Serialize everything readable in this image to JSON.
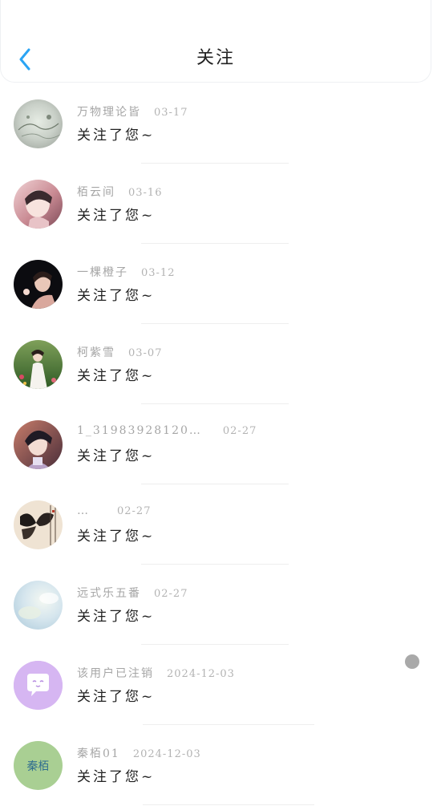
{
  "header": {
    "title": "关注",
    "back_icon": "chevron-left-icon",
    "accent": "#2aa4f4"
  },
  "items": [
    {
      "name": "万物理论皆",
      "date": "03-17",
      "message": "关注了您~",
      "avatar": "landscape-sketch"
    },
    {
      "name": "栢云间",
      "date": "03-16",
      "message": "关注了您~",
      "avatar": "anime-portrait"
    },
    {
      "name": "一棵橙子",
      "date": "03-12",
      "message": "关注了您~",
      "avatar": "dark-portrait"
    },
    {
      "name": "柯紫雪",
      "date": "03-07",
      "message": "关注了您~",
      "avatar": "nature-girl"
    },
    {
      "name": "1_31983928120…",
      "date": "02-27",
      "message": "关注了您~",
      "avatar": "anime-boy"
    },
    {
      "name": "…",
      "date": "02-27",
      "message": "关注了您~",
      "avatar": "butterfly-calligraphy"
    },
    {
      "name": "远式乐五番",
      "date": "02-27",
      "message": "关注了您~",
      "avatar": "sky-watercolor"
    },
    {
      "name": "该用户已注销",
      "date": "2024-12-03",
      "message": "关注了您~",
      "avatar": "default-chat-icon"
    },
    {
      "name": "秦栢01",
      "date": "2024-12-03",
      "message": "关注了您~",
      "avatar": "text-logo",
      "avatar_text": "秦栢"
    }
  ]
}
